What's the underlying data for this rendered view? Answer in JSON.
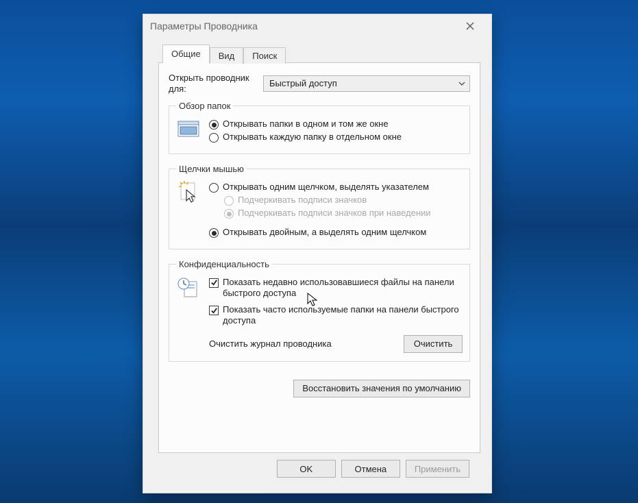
{
  "dialog": {
    "title": "Параметры Проводника"
  },
  "tabs": {
    "general": "Общие",
    "view": "Вид",
    "search": "Поиск"
  },
  "open": {
    "label": "Открыть проводник для:",
    "value": "Быстрый доступ"
  },
  "browse": {
    "legend": "Обзор папок",
    "same_window": "Открывать папки в одном и том же окне",
    "new_window": "Открывать каждую папку в отдельном окне"
  },
  "click": {
    "legend": "Щелчки мышью",
    "single": "Открывать одним щелчком, выделять указателем",
    "underline_always": "Подчеркивать подписи значков",
    "underline_hover": "Подчеркивать подписи значков при наведении",
    "double": "Открывать двойным, а выделять одним щелчком"
  },
  "privacy": {
    "legend": "Конфиденциальность",
    "recent_files": "Показать недавно использовавшиеся файлы на панели быстрого доступа",
    "frequent_folders": "Показать часто используемые папки на панели быстрого доступа",
    "clear_label": "Очистить журнал проводника",
    "clear_button": "Очистить"
  },
  "restore_defaults": "Восстановить значения по умолчанию",
  "buttons": {
    "ok": "OK",
    "cancel": "Отмена",
    "apply": "Применить"
  }
}
